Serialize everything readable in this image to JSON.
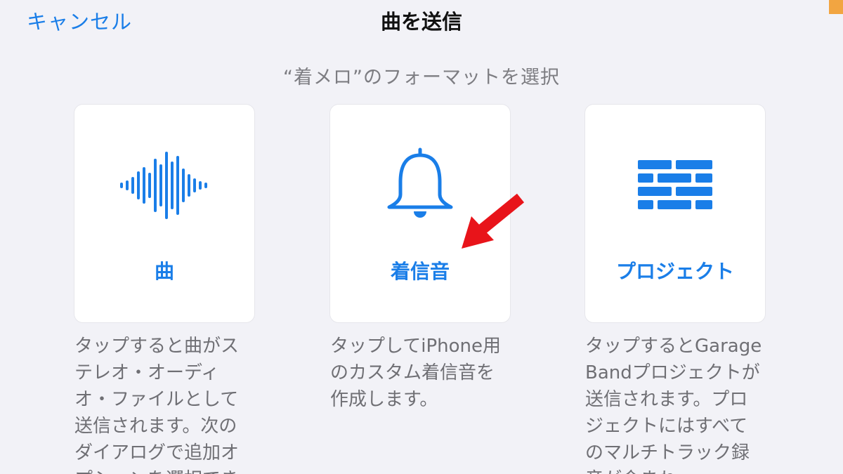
{
  "nav": {
    "cancel_label": "キャンセル",
    "title": "曲を送信"
  },
  "subtitle": "“着メロ”のフォーマットを選択",
  "options": [
    {
      "label": "曲",
      "icon": "waveform-icon",
      "description": "タップすると曲がステレオ・オーディオ・ファイルとして送信されます。次のダイアログで追加オプションを選択でき"
    },
    {
      "label": "着信音",
      "icon": "bell-icon",
      "description": "タップしてiPhone用のカスタム着信音を作成します。"
    },
    {
      "label": "プロジェクト",
      "icon": "brick-wall-icon",
      "description": "タップするとGarageBandプロジェクトが送信されます。プロジェクトにはすべてのマルチトラック録音が含まれ"
    }
  ],
  "colors": {
    "accent": "#1a7ee8",
    "background": "#f2f2f7",
    "card": "#ffffff",
    "annotation_arrow": "#e8141a"
  }
}
